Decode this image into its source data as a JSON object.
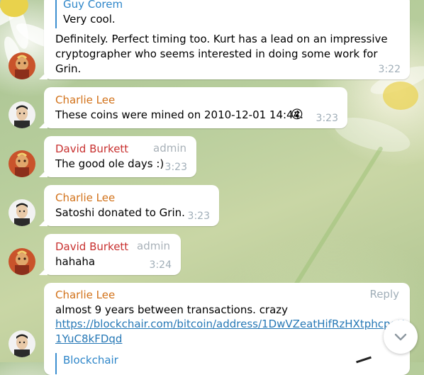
{
  "colors": {
    "name_orange": "#d2721a",
    "name_red": "#c8302f",
    "timestamp": "#a0aeb8",
    "link": "#2678b6",
    "quote": "#2e86c9"
  },
  "messages": [
    {
      "quote_sender": "Guy Corem",
      "quote_text": "Very cool.",
      "text": "Definitely. Perfect timing too. Kurt has a lead on an impressive cryptographer who seems interested in doing some work for Grin.",
      "time": "3:22"
    },
    {
      "sender": "Charlie Lee",
      "text": "These coins were mined on 2010-12-01 14:44.",
      "emoji": "😮",
      "time": "3:23"
    },
    {
      "sender": "David Burkett",
      "role": "admin",
      "text": "The good ole days :)",
      "time": "3:23"
    },
    {
      "sender": "Charlie Lee",
      "text": "Satoshi donated to Grin.",
      "time": "3:23"
    },
    {
      "sender": "David Burkett",
      "role": "admin",
      "text": "hahaha",
      "time": "3:24"
    },
    {
      "sender": "Charlie Lee",
      "reply_label": "Reply",
      "text": "almost 9 years between transactions. crazy",
      "link_line1": "https://blockchair.com/bitcoin/address/1DwVZeatHifRzHXtphcpqK",
      "link_line2": "1YuC8kFDqd",
      "preview_site": "Blockchair"
    }
  ]
}
